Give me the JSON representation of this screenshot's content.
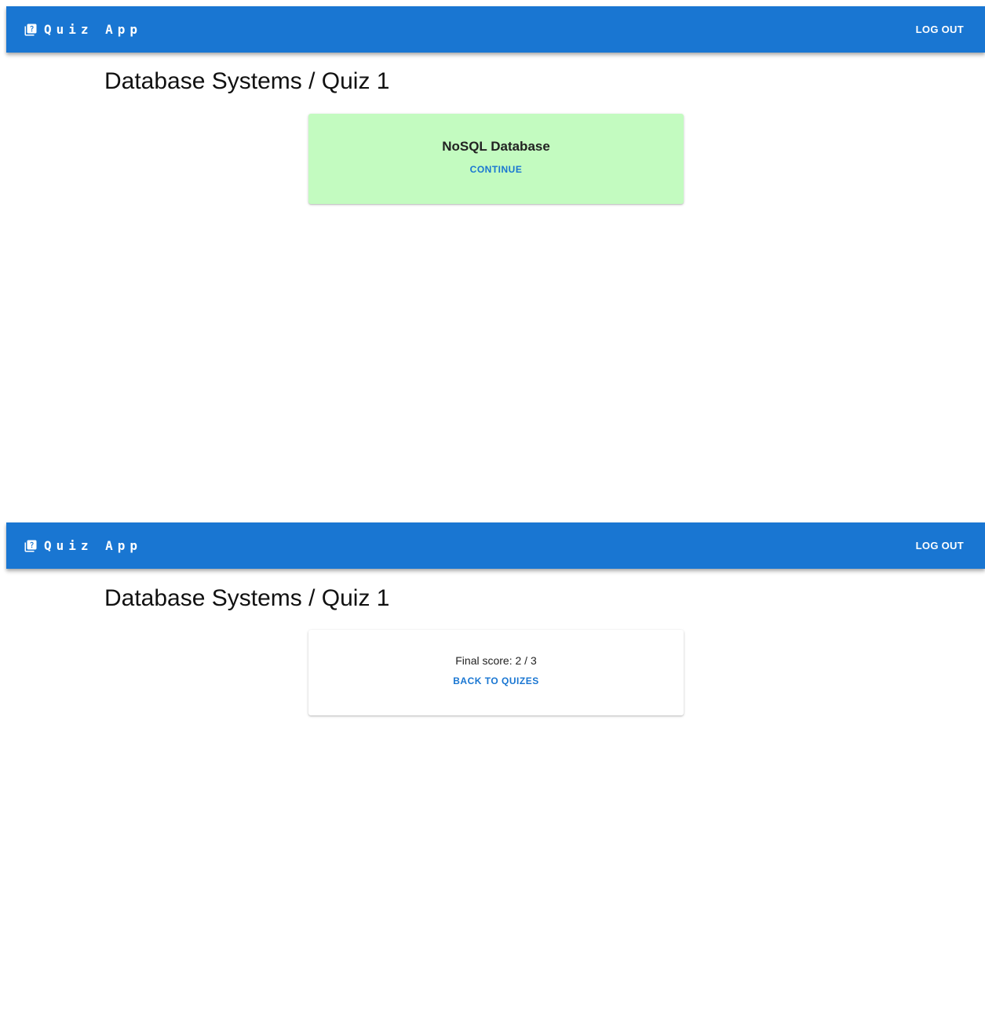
{
  "screens": [
    {
      "header": {
        "app_title": "Quiz App",
        "logout_label": "LOG OUT"
      },
      "page_title": "Database Systems / Quiz 1",
      "card": {
        "title": "NoSQL Database",
        "action_label": "CONTINUE",
        "background": "#c3fbc0"
      }
    },
    {
      "header": {
        "app_title": "Quiz App",
        "logout_label": "LOG OUT"
      },
      "page_title": "Database Systems / Quiz 1",
      "card": {
        "text": "Final score: 2 / 3",
        "action_label": "BACK TO QUIZES"
      }
    }
  ],
  "colors": {
    "appbar": "#1976d2",
    "accent": "#1976d2",
    "correct_answer": "#c3fbc0"
  },
  "icons": {
    "brand": "quiz-icon"
  }
}
